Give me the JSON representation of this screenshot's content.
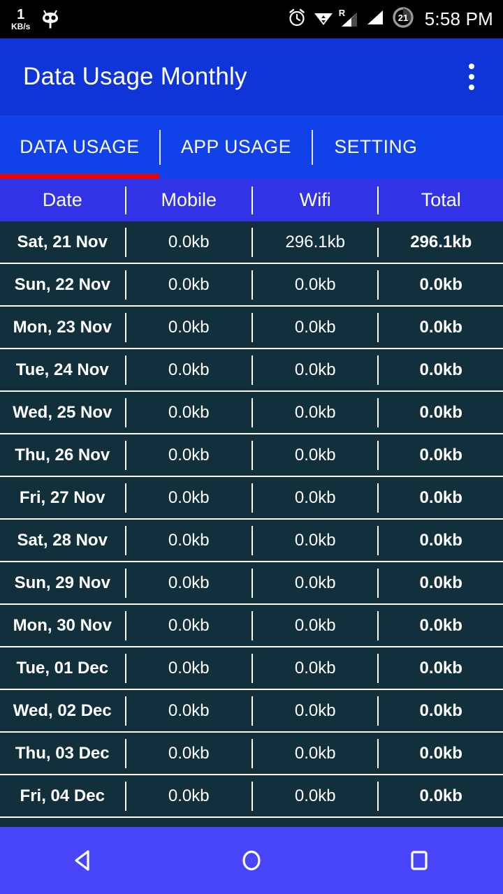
{
  "status_bar": {
    "net_speed_value": "1",
    "net_speed_unit": "KB/s",
    "icons": [
      "cyanogenmod-mascot-icon",
      "alarm-icon",
      "wifi-icon",
      "roaming-signal-icon",
      "signal-icon",
      "battery-icon"
    ],
    "roaming_label": "R",
    "battery_percent": "21",
    "time": "5:58 PM"
  },
  "app_bar": {
    "title": "Data Usage Monthly",
    "overflow_label": "More options"
  },
  "tabs": [
    {
      "label": "DATA USAGE",
      "active": true
    },
    {
      "label": "APP USAGE",
      "active": false
    },
    {
      "label": "SETTING",
      "active": false
    }
  ],
  "table": {
    "columns": [
      "Date",
      "Mobile",
      "Wifi",
      "Total"
    ],
    "rows": [
      {
        "date": "Sat, 21 Nov",
        "mobile": "0.0kb",
        "wifi": "296.1kb",
        "total": "296.1kb"
      },
      {
        "date": "Sun, 22 Nov",
        "mobile": "0.0kb",
        "wifi": "0.0kb",
        "total": "0.0kb"
      },
      {
        "date": "Mon, 23 Nov",
        "mobile": "0.0kb",
        "wifi": "0.0kb",
        "total": "0.0kb"
      },
      {
        "date": "Tue, 24 Nov",
        "mobile": "0.0kb",
        "wifi": "0.0kb",
        "total": "0.0kb"
      },
      {
        "date": "Wed, 25 Nov",
        "mobile": "0.0kb",
        "wifi": "0.0kb",
        "total": "0.0kb"
      },
      {
        "date": "Thu, 26 Nov",
        "mobile": "0.0kb",
        "wifi": "0.0kb",
        "total": "0.0kb"
      },
      {
        "date": "Fri, 27 Nov",
        "mobile": "0.0kb",
        "wifi": "0.0kb",
        "total": "0.0kb"
      },
      {
        "date": "Sat, 28 Nov",
        "mobile": "0.0kb",
        "wifi": "0.0kb",
        "total": "0.0kb"
      },
      {
        "date": "Sun, 29 Nov",
        "mobile": "0.0kb",
        "wifi": "0.0kb",
        "total": "0.0kb"
      },
      {
        "date": "Mon, 30 Nov",
        "mobile": "0.0kb",
        "wifi": "0.0kb",
        "total": "0.0kb"
      },
      {
        "date": "Tue, 01 Dec",
        "mobile": "0.0kb",
        "wifi": "0.0kb",
        "total": "0.0kb"
      },
      {
        "date": "Wed, 02 Dec",
        "mobile": "0.0kb",
        "wifi": "0.0kb",
        "total": "0.0kb"
      },
      {
        "date": "Thu, 03 Dec",
        "mobile": "0.0kb",
        "wifi": "0.0kb",
        "total": "0.0kb"
      },
      {
        "date": "Fri, 04 Dec",
        "mobile": "0.0kb",
        "wifi": "0.0kb",
        "total": "0.0kb"
      }
    ]
  },
  "nav_bar": {
    "buttons": [
      "back-button",
      "home-button",
      "recents-button"
    ]
  },
  "colors": {
    "status_bar_bg": "#000000",
    "app_bar_bg": "#0f34d8",
    "tab_bar_bg": "#1141e8",
    "tab_indicator": "#ee0000",
    "table_header_bg": "#3232e6",
    "row_bg": "#12303c",
    "divider": "#ffffff",
    "nav_bar_bg": "#4845fb",
    "text": "#ffffff"
  }
}
